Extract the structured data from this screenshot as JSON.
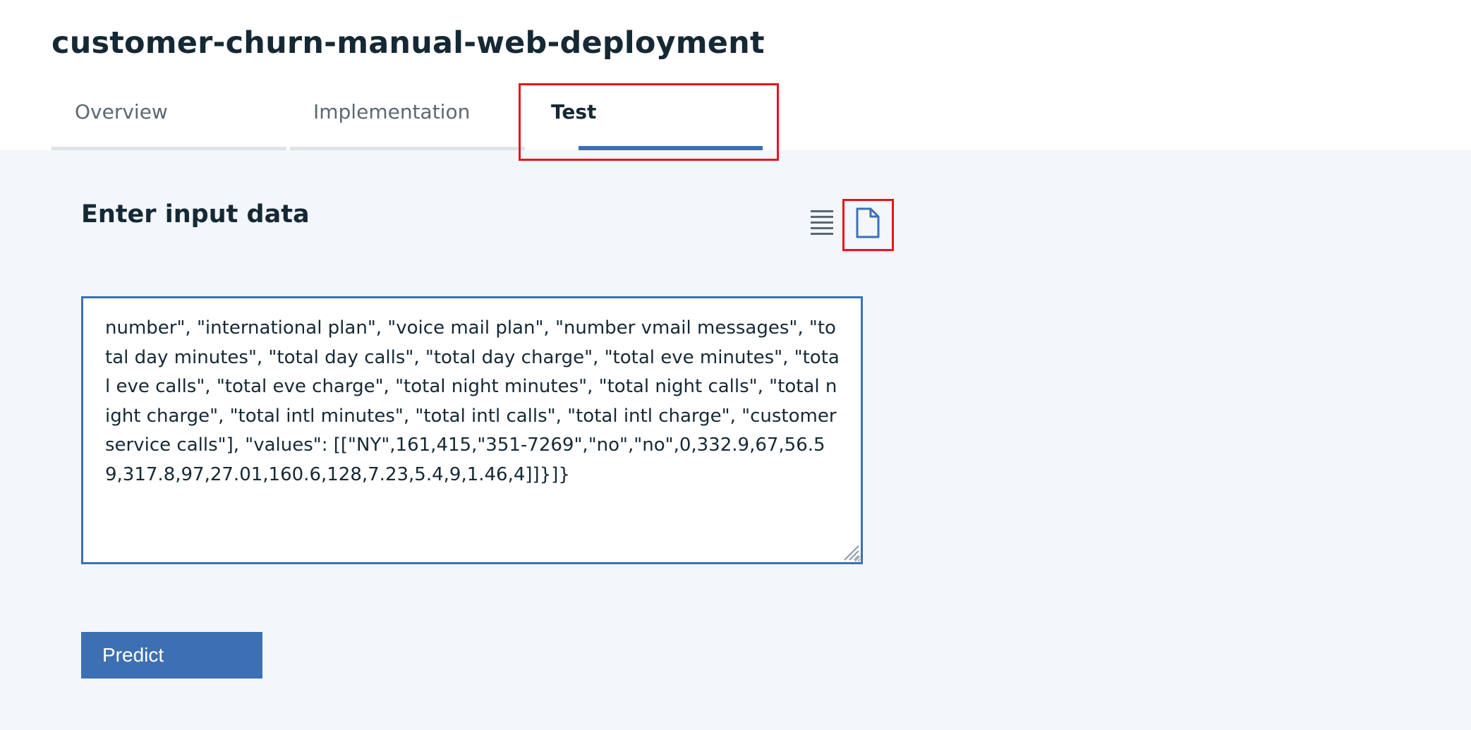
{
  "page": {
    "title": "customer-churn-manual-web-deployment"
  },
  "tabs": [
    {
      "label": "Overview",
      "active": false
    },
    {
      "label": "Implementation",
      "active": false
    },
    {
      "label": "Test",
      "active": true
    }
  ],
  "test_panel": {
    "section_title": "Enter input data",
    "view_toggle": {
      "icons": [
        "list-icon",
        "file-icon"
      ],
      "selected": "file-icon"
    },
    "input_value": "number\", \"international plan\", \"voice mail plan\", \"number vmail messages\", \"total day minutes\", \"total day calls\", \"total day charge\", \"total eve minutes\", \"total eve calls\", \"total eve charge\", \"total night minutes\", \"total night calls\", \"total night charge\", \"total intl minutes\", \"total intl calls\", \"total intl charge\", \"customer service calls\"], \"values\": [[\"NY\",161,415,\"351-7269\",\"no\",\"no\",0,332.9,67,56.59,317.8,97,27.01,160.6,128,7.23,5.4,9,1.46,4]]}]}",
    "predict_label": "Predict"
  },
  "colors": {
    "accent": "#3d70b2",
    "annotation": "#e8141c",
    "panel_background": "#f3f6fa",
    "text": "#152935"
  }
}
